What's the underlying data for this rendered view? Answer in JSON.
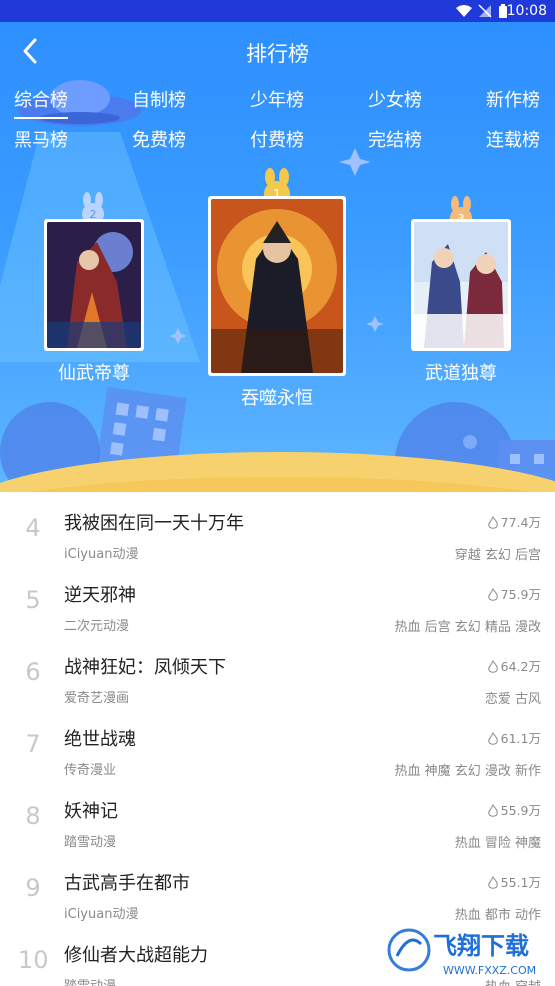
{
  "status_bar": {
    "time": "10:08"
  },
  "header": {
    "title": "排行榜"
  },
  "tabs": [
    {
      "label": "综合榜",
      "active": true
    },
    {
      "label": "自制榜"
    },
    {
      "label": "少年榜"
    },
    {
      "label": "少女榜"
    },
    {
      "label": "新作榜"
    },
    {
      "label": "黑马榜"
    },
    {
      "label": "免费榜"
    },
    {
      "label": "付费榜"
    },
    {
      "label": "完结榜"
    },
    {
      "label": "连载榜"
    }
  ],
  "podium": [
    {
      "rank": "1",
      "name": "吞噬永恒",
      "cover_text": "吞噬永恒"
    },
    {
      "rank": "2",
      "name": "仙武帝尊",
      "cover_text": "仙武帝尊"
    },
    {
      "rank": "3",
      "name": "武道独尊",
      "cover_text": "武道独尊"
    }
  ],
  "list": [
    {
      "rank": "4",
      "title": "我被困在同一天十万年",
      "publisher": "iCiyuan动漫",
      "hot": "77.4万",
      "tags": "穿越 玄幻 后宫"
    },
    {
      "rank": "5",
      "title": "逆天邪神",
      "publisher": "二次元动漫",
      "hot": "75.9万",
      "tags": "热血 后宫 玄幻 精品 漫改"
    },
    {
      "rank": "6",
      "title": "战神狂妃：凤倾天下",
      "publisher": "爱奇艺漫画",
      "hot": "64.2万",
      "tags": "恋爱 古风"
    },
    {
      "rank": "7",
      "title": "绝世战魂",
      "publisher": "传奇漫业",
      "hot": "61.1万",
      "tags": "热血 神魔 玄幻 漫改 新作"
    },
    {
      "rank": "8",
      "title": "妖神记",
      "publisher": "踏雪动漫",
      "hot": "55.9万",
      "tags": "热血 冒险 神魔"
    },
    {
      "rank": "9",
      "title": "古武高手在都市",
      "publisher": "iCiyuan动漫",
      "hot": "55.1万",
      "tags": "热血 都市 动作"
    },
    {
      "rank": "10",
      "title": "修仙者大战超能力",
      "publisher": "踏雪动漫",
      "hot": "",
      "tags": "热血 穿越"
    }
  ],
  "watermark": {
    "text": "飞翔下载",
    "url": "WWW.FXXZ.COM"
  },
  "colors": {
    "status_bar": "#1f3ad8",
    "hero_top": "#2e8fff",
    "moon": "#f7d16d",
    "rank_gray": "#c8c8c8"
  }
}
